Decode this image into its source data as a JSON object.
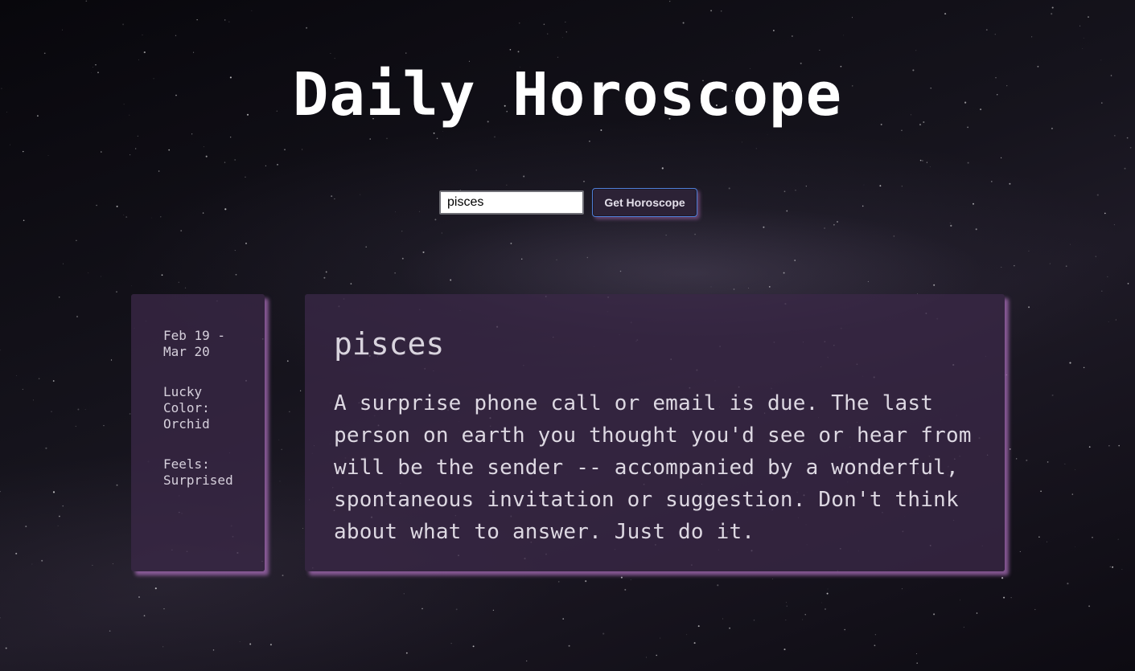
{
  "page": {
    "title": "Daily Horoscope"
  },
  "search": {
    "value": "pisces",
    "button_label": "Get Horoscope"
  },
  "result": {
    "sign": "pisces",
    "date_range": "Feb 19 - Mar 20",
    "lucky_color": "Lucky Color: Orchid",
    "mood": "Feels: Surprised",
    "description": "A surprise phone call or email is due. The last person on earth you thought you'd see or hear from will be the sender -- accompanied by a wonderful, spontaneous invitation or suggestion. Don't think about what to answer. Just do it."
  },
  "colors": {
    "card_background": "#3a2846",
    "card_glow": "#aa6eb9",
    "button_border": "#4e7fd6",
    "button_background": "#2c2236"
  }
}
